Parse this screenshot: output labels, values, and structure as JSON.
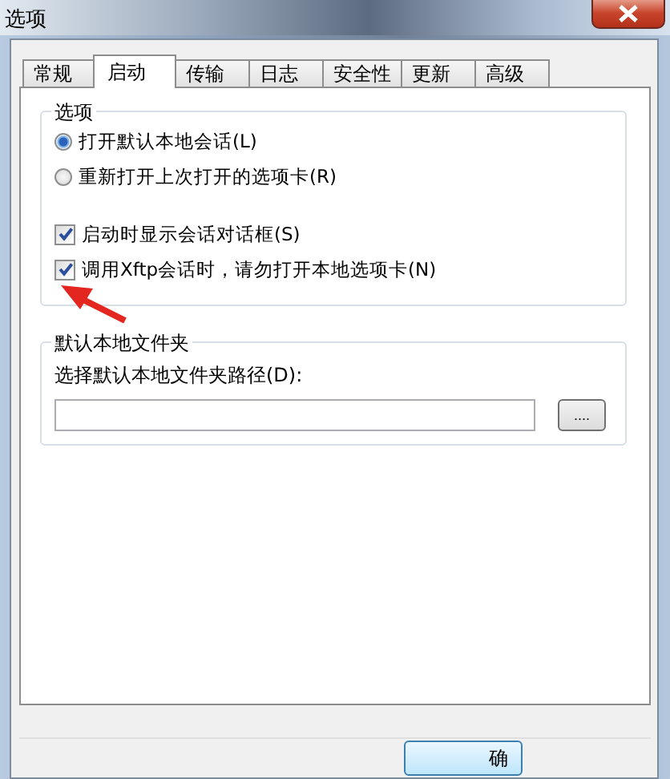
{
  "window": {
    "title": "选项"
  },
  "tabs": [
    {
      "label": "常规",
      "selected": false
    },
    {
      "label": "启动",
      "selected": true
    },
    {
      "label": "传输",
      "selected": false
    },
    {
      "label": "日志",
      "selected": false
    },
    {
      "label": "安全性",
      "selected": false
    },
    {
      "label": "更新",
      "selected": false
    },
    {
      "label": "高级",
      "selected": false
    }
  ],
  "options_group": {
    "title": "选项",
    "items": [
      {
        "kind": "radio",
        "label": "打开默认本地会话(L)",
        "selected": true
      },
      {
        "kind": "radio",
        "label": "重新打开上次打开的选项卡(R)",
        "selected": false
      },
      {
        "kind": "checkbox",
        "label": "启动时显示会话对话框(S)",
        "checked": true
      },
      {
        "kind": "checkbox",
        "label": "调用Xftp会话时，请勿打开本地选项卡(N)",
        "checked": true
      }
    ]
  },
  "folder_group": {
    "title": "默认本地文件夹",
    "field_label": "选择默认本地文件夹路径(D):",
    "browse_button": "...."
  },
  "buttons": [
    "确"
  ]
}
